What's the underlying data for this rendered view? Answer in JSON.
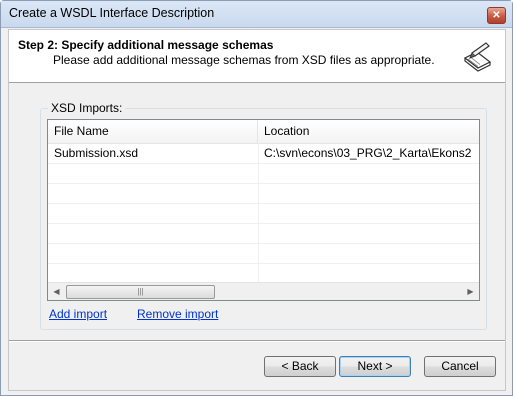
{
  "window": {
    "title": "Create a WSDL Interface Description",
    "close_glyph": "✕"
  },
  "header": {
    "step_title": "Step 2: Specify additional message schemas",
    "step_subtitle": "Please add additional message schemas from XSD files as appropriate.",
    "icon": "wizard-pencil-document-icon"
  },
  "imports": {
    "group_label": "XSD Imports:",
    "columns": [
      "File Name",
      "Location"
    ],
    "rows": [
      {
        "file": "Submission.xsd",
        "location": "C:\\svn\\econs\\03_PRG\\2_Karta\\Ekons2"
      }
    ],
    "scroll_left": "◀",
    "scroll_right": "▶",
    "scroll_grip": "|||"
  },
  "links": {
    "add": "Add import",
    "remove": "Remove import"
  },
  "buttons": {
    "back": "< Back",
    "next": "Next >",
    "cancel": "Cancel"
  }
}
